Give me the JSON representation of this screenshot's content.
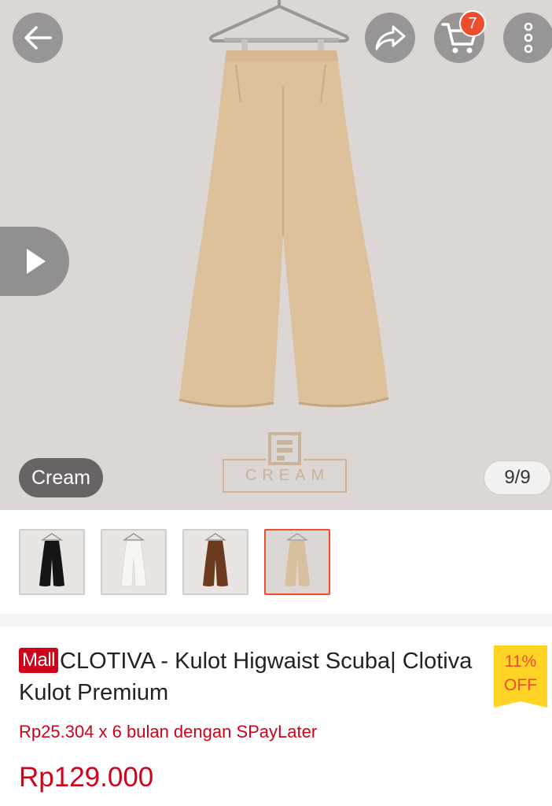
{
  "header": {
    "cart_count": "7",
    "icons": [
      "back-arrow-icon",
      "share-icon",
      "cart-icon",
      "more-vertical-icon"
    ]
  },
  "hero": {
    "variant_label": "Cream",
    "image_counter": "9/9",
    "watermark_text": "CREAM",
    "play_icon": "play-icon"
  },
  "thumbnails": [
    {
      "color": "#151515",
      "active": false
    },
    {
      "color": "#f3f1ee",
      "active": false
    },
    {
      "color": "#6b3a1f",
      "active": false
    },
    {
      "color": "#d8bf9e",
      "active": true
    }
  ],
  "product": {
    "mall_badge": "Mall",
    "title": "CLOTIVA - Kulot Higwaist Scuba| Clotiva Kulot Premium",
    "discount_percent": "11%",
    "discount_label": "OFF",
    "installment": "Rp25.304 x 6 bulan dengan SPayLater",
    "price": "Rp129.000"
  },
  "colors": {
    "accent": "#ee4d2d",
    "mall_red": "#d0011b",
    "discount_yellow": "#ffd424",
    "background": "#dcd6d4"
  }
}
